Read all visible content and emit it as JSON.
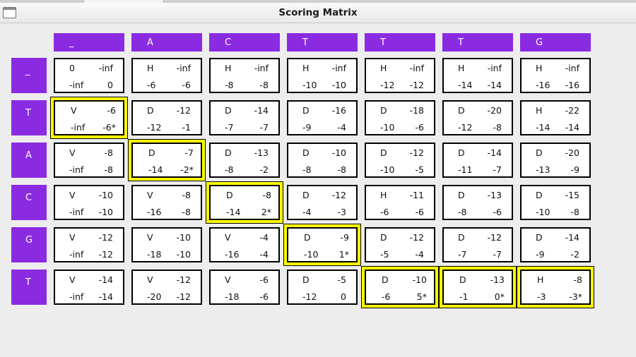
{
  "window": {
    "title": "Scoring Matrix"
  },
  "columns": [
    "_",
    "A",
    "C",
    "T",
    "T",
    "T",
    "G"
  ],
  "rows": [
    {
      "label": "_",
      "cells": [
        {
          "tl": "0",
          "tr": "-inf",
          "bl": "-inf",
          "br": "0",
          "hl": false
        },
        {
          "tl": "H",
          "tr": "-inf",
          "bl": "-6",
          "br": "-6",
          "hl": false
        },
        {
          "tl": "H",
          "tr": "-inf",
          "bl": "-8",
          "br": "-8",
          "hl": false
        },
        {
          "tl": "H",
          "tr": "-inf",
          "bl": "-10",
          "br": "-10",
          "hl": false
        },
        {
          "tl": "H",
          "tr": "-inf",
          "bl": "-12",
          "br": "-12",
          "hl": false
        },
        {
          "tl": "H",
          "tr": "-inf",
          "bl": "-14",
          "br": "-14",
          "hl": false
        },
        {
          "tl": "H",
          "tr": "-inf",
          "bl": "-16",
          "br": "-16",
          "hl": false
        }
      ]
    },
    {
      "label": "T",
      "cells": [
        {
          "tl": "V",
          "tr": "-6",
          "bl": "-inf",
          "br": "-6*",
          "hl": true
        },
        {
          "tl": "D",
          "tr": "-12",
          "bl": "-12",
          "br": "-1",
          "hl": false
        },
        {
          "tl": "D",
          "tr": "-14",
          "bl": "-7",
          "br": "-7",
          "hl": false
        },
        {
          "tl": "D",
          "tr": "-16",
          "bl": "-9",
          "br": "-4",
          "hl": false
        },
        {
          "tl": "D",
          "tr": "-18",
          "bl": "-10",
          "br": "-6",
          "hl": false
        },
        {
          "tl": "D",
          "tr": "-20",
          "bl": "-12",
          "br": "-8",
          "hl": false
        },
        {
          "tl": "H",
          "tr": "-22",
          "bl": "-14",
          "br": "-14",
          "hl": false
        }
      ]
    },
    {
      "label": "A",
      "cells": [
        {
          "tl": "V",
          "tr": "-8",
          "bl": "-inf",
          "br": "-8",
          "hl": false
        },
        {
          "tl": "D",
          "tr": "-7",
          "bl": "-14",
          "br": "-2*",
          "hl": true
        },
        {
          "tl": "D",
          "tr": "-13",
          "bl": "-8",
          "br": "-2",
          "hl": false
        },
        {
          "tl": "D",
          "tr": "-10",
          "bl": "-8",
          "br": "-8",
          "hl": false
        },
        {
          "tl": "D",
          "tr": "-12",
          "bl": "-10",
          "br": "-5",
          "hl": false
        },
        {
          "tl": "D",
          "tr": "-14",
          "bl": "-11",
          "br": "-7",
          "hl": false
        },
        {
          "tl": "D",
          "tr": "-20",
          "bl": "-13",
          "br": "-9",
          "hl": false
        }
      ]
    },
    {
      "label": "C",
      "cells": [
        {
          "tl": "V",
          "tr": "-10",
          "bl": "-inf",
          "br": "-10",
          "hl": false
        },
        {
          "tl": "V",
          "tr": "-8",
          "bl": "-16",
          "br": "-8",
          "hl": false
        },
        {
          "tl": "D",
          "tr": "-8",
          "bl": "-14",
          "br": "2*",
          "hl": true
        },
        {
          "tl": "D",
          "tr": "-12",
          "bl": "-4",
          "br": "-3",
          "hl": false
        },
        {
          "tl": "H",
          "tr": "-11",
          "bl": "-6",
          "br": "-6",
          "hl": false
        },
        {
          "tl": "D",
          "tr": "-13",
          "bl": "-8",
          "br": "-6",
          "hl": false
        },
        {
          "tl": "D",
          "tr": "-15",
          "bl": "-10",
          "br": "-8",
          "hl": false
        }
      ]
    },
    {
      "label": "G",
      "cells": [
        {
          "tl": "V",
          "tr": "-12",
          "bl": "-inf",
          "br": "-12",
          "hl": false
        },
        {
          "tl": "V",
          "tr": "-10",
          "bl": "-18",
          "br": "-10",
          "hl": false
        },
        {
          "tl": "V",
          "tr": "-4",
          "bl": "-16",
          "br": "-4",
          "hl": false
        },
        {
          "tl": "D",
          "tr": "-9",
          "bl": "-10",
          "br": "1*",
          "hl": true
        },
        {
          "tl": "D",
          "tr": "-12",
          "bl": "-5",
          "br": "-4",
          "hl": false
        },
        {
          "tl": "D",
          "tr": "-12",
          "bl": "-7",
          "br": "-7",
          "hl": false
        },
        {
          "tl": "D",
          "tr": "-14",
          "bl": "-9",
          "br": "-2",
          "hl": false
        }
      ]
    },
    {
      "label": "T",
      "cells": [
        {
          "tl": "V",
          "tr": "-14",
          "bl": "-inf",
          "br": "-14",
          "hl": false
        },
        {
          "tl": "V",
          "tr": "-12",
          "bl": "-20",
          "br": "-12",
          "hl": false
        },
        {
          "tl": "V",
          "tr": "-6",
          "bl": "-18",
          "br": "-6",
          "hl": false
        },
        {
          "tl": "D",
          "tr": "-5",
          "bl": "-12",
          "br": "0",
          "hl": false
        },
        {
          "tl": "D",
          "tr": "-10",
          "bl": "-6",
          "br": "5*",
          "hl": true
        },
        {
          "tl": "D",
          "tr": "-13",
          "bl": "-1",
          "br": "0*",
          "hl": true
        },
        {
          "tl": "H",
          "tr": "-8",
          "bl": "-3",
          "br": "-3*",
          "hl": true
        }
      ]
    }
  ]
}
